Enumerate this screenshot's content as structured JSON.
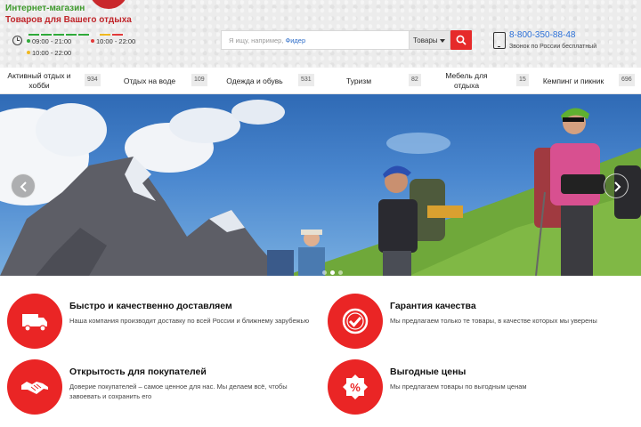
{
  "header": {
    "brand_line1": "Интернет-магазин",
    "brand_line2": "Товаров для Вашего отдыха",
    "hours": [
      {
        "text": "09:00 - 21:00",
        "color": "#2faa3a"
      },
      {
        "text": "10:00 - 22:00",
        "color": "#e23a3a"
      },
      {
        "text": "10:00 - 22:00",
        "color": "#f0b820"
      }
    ],
    "day_colors": [
      "#2faa3a",
      "#2faa3a",
      "#2faa3a",
      "#2faa3a",
      "#2faa3a",
      "#f0b820",
      "#e23a3a"
    ],
    "search": {
      "placeholder": "Я ищу, например,",
      "placeholder_hint": "Фидер",
      "category": "Товары"
    },
    "phone": {
      "number": "8-800-350-88-48",
      "note": "Звонок по России бесплатный"
    }
  },
  "nav": [
    {
      "label": "Активный отдых и хобби",
      "count": "934"
    },
    {
      "label": "Отдых на воде",
      "count": "109"
    },
    {
      "label": "Одежда и обувь",
      "count": "531"
    },
    {
      "label": "Туризм",
      "count": "82"
    },
    {
      "label": "Мебель для отдыха",
      "count": "15"
    },
    {
      "label": "Кемпинг и пикник",
      "count": "696"
    }
  ],
  "slider": {
    "prev_icon": "chevron-left-icon",
    "next_icon": "chevron-right-icon",
    "slide_count": 3,
    "active_slide": 1
  },
  "features": [
    {
      "icon": "truck-icon",
      "title": "Быстро и качественно доставляем",
      "text": "Наша компания производит доставку по всей России и ближнему зарубежью"
    },
    {
      "icon": "check-badge-icon",
      "title": "Гарантия качества",
      "text": "Мы предлагаем только те товары, в качестве которых мы уверены"
    },
    {
      "icon": "handshake-icon",
      "title": "Открытость для покупателей",
      "text": "Доверие покупателей – самое ценное для нас. Мы делаем всё, чтобы завоевать и сохранить его"
    },
    {
      "icon": "percent-icon",
      "title": "Выгодные цены",
      "text": "Мы предлагаем товары по выгодным ценам"
    }
  ],
  "colors": {
    "accent": "#e62a2a",
    "link": "#2b6fd6",
    "brand_green": "#3e9a2c",
    "brand_red": "#c0262b"
  }
}
